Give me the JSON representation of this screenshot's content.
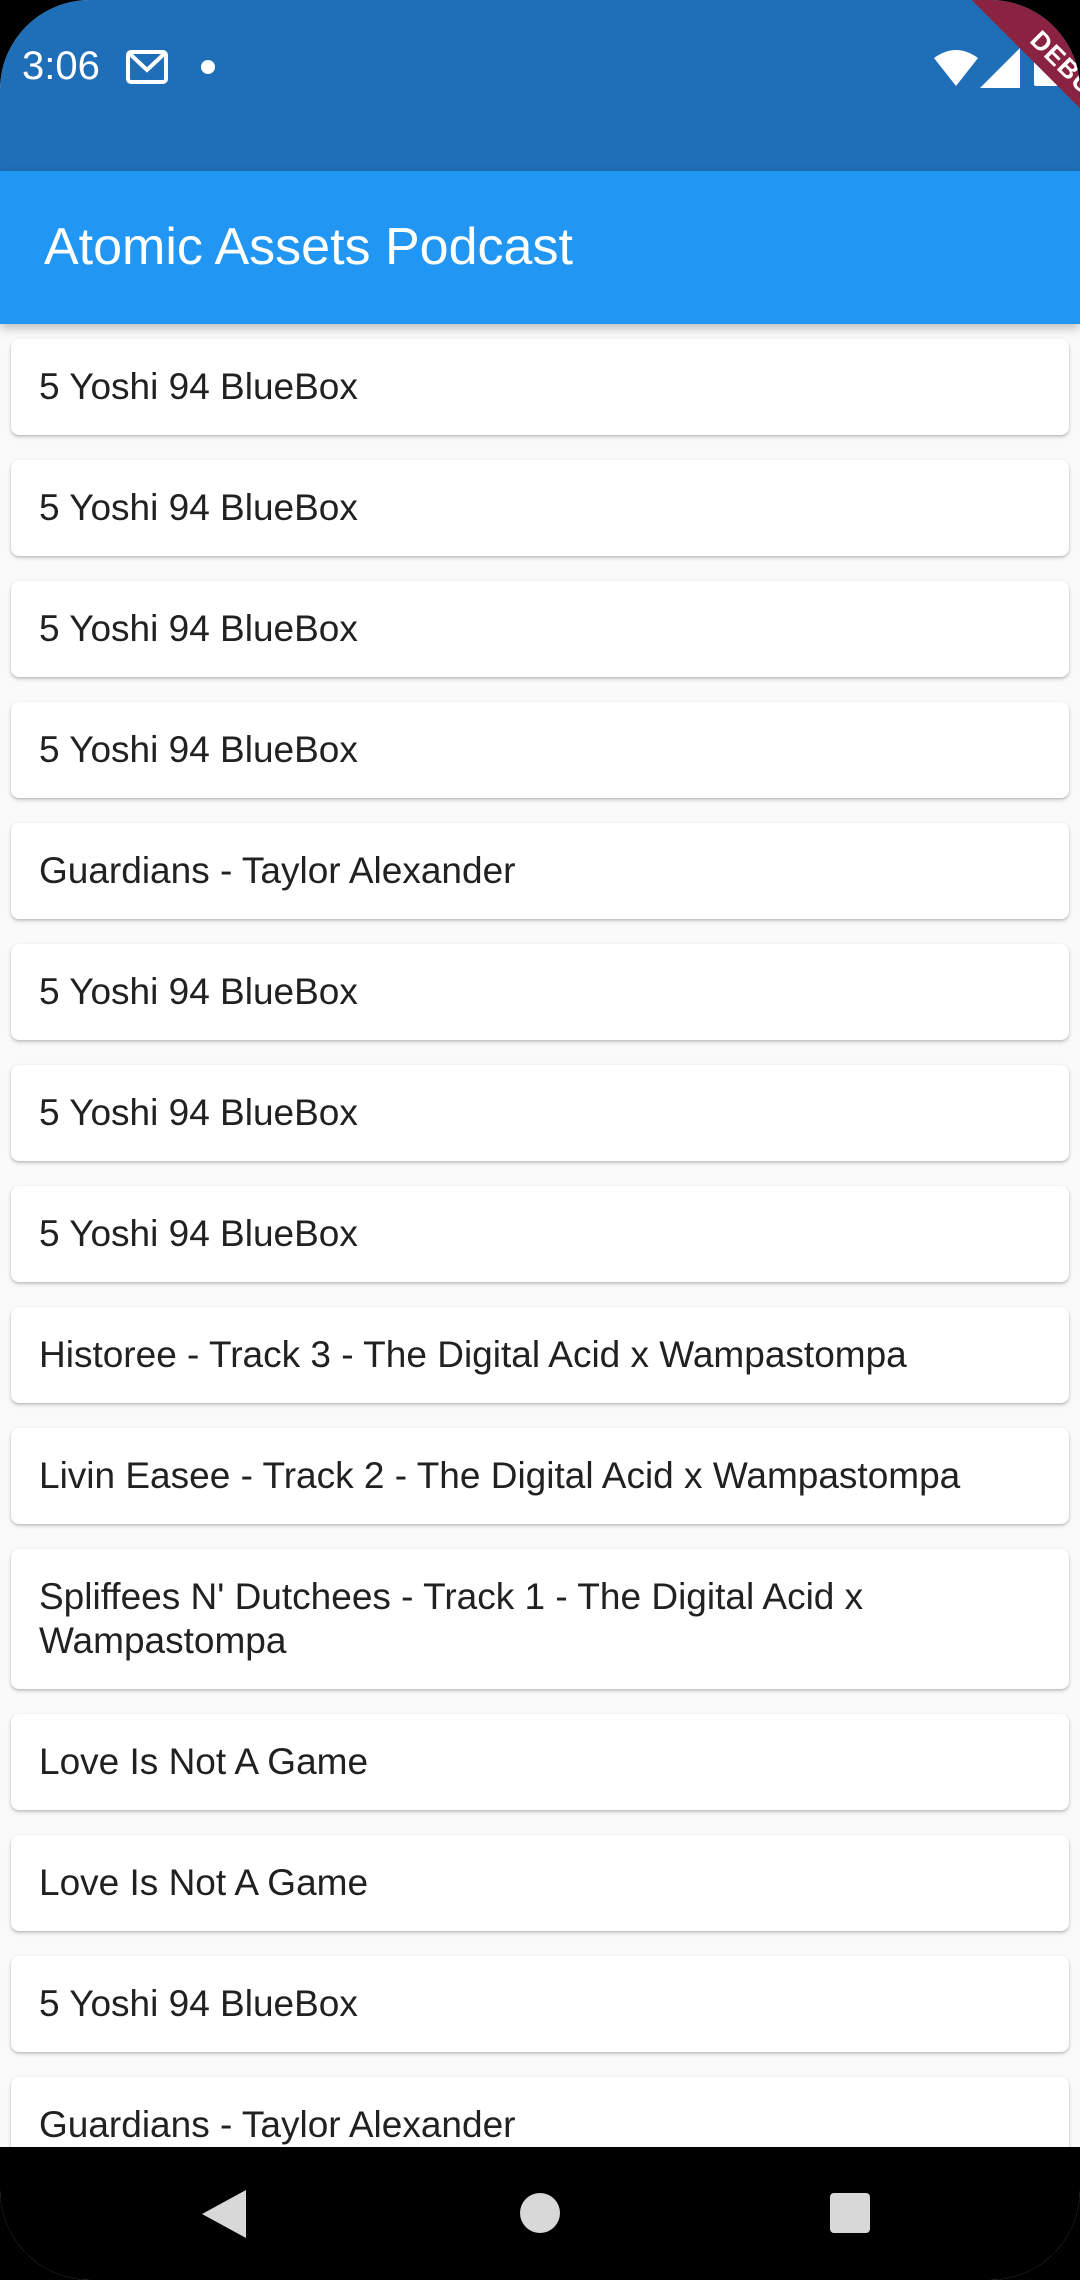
{
  "status_bar": {
    "time": "3:06",
    "debug_label": "DEBUG"
  },
  "app_bar": {
    "title": "Atomic Assets Podcast"
  },
  "episodes": [
    "5 Yoshi 94 BlueBox",
    "5 Yoshi 94 BlueBox",
    "5 Yoshi 94 BlueBox",
    "5 Yoshi 94 BlueBox",
    "Guardians - Taylor Alexander",
    "5 Yoshi 94 BlueBox",
    "5 Yoshi 94 BlueBox",
    "5 Yoshi 94 BlueBox",
    "Historee - Track 3 - The Digital Acid x Wampastompa",
    "Livin Easee - Track 2 - The Digital Acid x Wampastompa",
    "Spliffees N' Dutchees - Track 1 - The Digital Acid x Wampastompa",
    "Love Is Not A Game",
    "Love Is Not A Game",
    "5 Yoshi 94 BlueBox",
    "Guardians - Taylor Alexander"
  ],
  "colors": {
    "status_bar": "#1f6fb8",
    "app_bar": "#2196f3",
    "background": "#fafafa",
    "debug_ribbon": "#8a2241"
  }
}
